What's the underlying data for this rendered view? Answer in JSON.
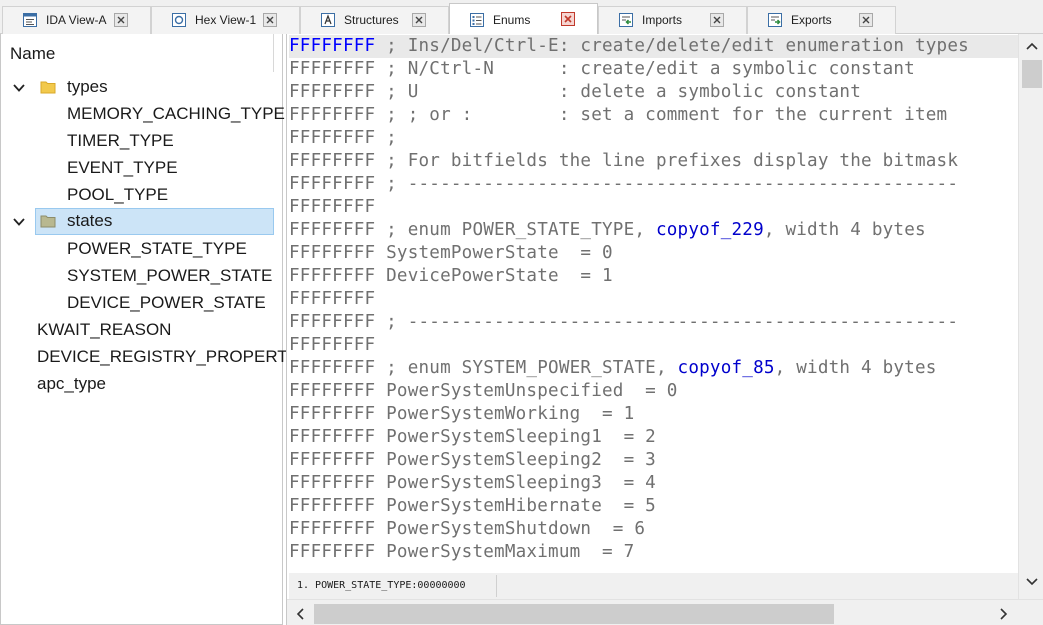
{
  "tabs": [
    {
      "label": "IDA View-A",
      "icon": "disassembly-view-icon",
      "active": false
    },
    {
      "label": "Hex View-1",
      "icon": "hex-view-icon",
      "active": false
    },
    {
      "label": "Structures",
      "icon": "structures-icon",
      "active": false
    },
    {
      "label": "Enums",
      "icon": "enums-icon",
      "active": true
    },
    {
      "label": "Imports",
      "icon": "imports-icon",
      "active": false
    },
    {
      "label": "Exports",
      "icon": "exports-icon",
      "active": false
    }
  ],
  "tree": {
    "header": "Name",
    "nodes": [
      {
        "label": "types",
        "kind": "folder",
        "expanded": true
      },
      {
        "label": "MEMORY_CACHING_TYPE"
      },
      {
        "label": "TIMER_TYPE"
      },
      {
        "label": "EVENT_TYPE"
      },
      {
        "label": "POOL_TYPE"
      },
      {
        "label": "states",
        "kind": "folder",
        "expanded": true,
        "selected": true
      },
      {
        "label": "POWER_STATE_TYPE"
      },
      {
        "label": "SYSTEM_POWER_STATE"
      },
      {
        "label": "DEVICE_POWER_STATE"
      },
      {
        "label": "KWAIT_REASON"
      },
      {
        "label": "DEVICE_REGISTRY_PROPERTY"
      },
      {
        "label": "apc_type"
      }
    ]
  },
  "listing": {
    "lines": [
      {
        "addr": "FFFFFFFF",
        "pre": " ; Ins/Del/Ctrl-E: create/delete/edit enumeration types",
        "ref": "",
        "post": ""
      },
      {
        "addr": "FFFFFFFF",
        "pre": " ; N/Ctrl-N      : create/edit a symbolic constant",
        "ref": "",
        "post": ""
      },
      {
        "addr": "FFFFFFFF",
        "pre": " ; U             : delete a symbolic constant",
        "ref": "",
        "post": ""
      },
      {
        "addr": "FFFFFFFF",
        "pre": " ; ; or :        : set a comment for the current item",
        "ref": "",
        "post": ""
      },
      {
        "addr": "FFFFFFFF",
        "pre": " ;",
        "ref": "",
        "post": ""
      },
      {
        "addr": "FFFFFFFF",
        "pre": " ; For bitfields the line prefixes display the bitmask",
        "ref": "",
        "post": ""
      },
      {
        "addr": "FFFFFFFF",
        "pre": " ; ---------------------------------------------------",
        "ref": "",
        "post": ""
      },
      {
        "addr": "FFFFFFFF",
        "pre": "",
        "ref": "",
        "post": ""
      },
      {
        "addr": "FFFFFFFF",
        "pre": " ; enum POWER_STATE_TYPE, ",
        "ref": "copyof_229",
        "post": ", width 4 bytes"
      },
      {
        "addr": "FFFFFFFF",
        "pre": " SystemPowerState  = 0",
        "ref": "",
        "post": ""
      },
      {
        "addr": "FFFFFFFF",
        "pre": " DevicePowerState  = 1",
        "ref": "",
        "post": ""
      },
      {
        "addr": "FFFFFFFF",
        "pre": "",
        "ref": "",
        "post": ""
      },
      {
        "addr": "FFFFFFFF",
        "pre": " ; ---------------------------------------------------",
        "ref": "",
        "post": ""
      },
      {
        "addr": "FFFFFFFF",
        "pre": "",
        "ref": "",
        "post": ""
      },
      {
        "addr": "FFFFFFFF",
        "pre": " ; enum SYSTEM_POWER_STATE, ",
        "ref": "copyof_85",
        "post": ", width 4 bytes"
      },
      {
        "addr": "FFFFFFFF",
        "pre": " PowerSystemUnspecified  = 0",
        "ref": "",
        "post": ""
      },
      {
        "addr": "FFFFFFFF",
        "pre": " PowerSystemWorking  = 1",
        "ref": "",
        "post": ""
      },
      {
        "addr": "FFFFFFFF",
        "pre": " PowerSystemSleeping1  = 2",
        "ref": "",
        "post": ""
      },
      {
        "addr": "FFFFFFFF",
        "pre": " PowerSystemSleeping2  = 3",
        "ref": "",
        "post": ""
      },
      {
        "addr": "FFFFFFFF",
        "pre": " PowerSystemSleeping3  = 4",
        "ref": "",
        "post": ""
      },
      {
        "addr": "FFFFFFFF",
        "pre": " PowerSystemHibernate  = 5",
        "ref": "",
        "post": ""
      },
      {
        "addr": "FFFFFFFF",
        "pre": " PowerSystemShutdown  = 6",
        "ref": "",
        "post": ""
      },
      {
        "addr": "FFFFFFFF",
        "pre": " PowerSystemMaximum  = 7",
        "ref": "",
        "post": ""
      }
    ],
    "status": "1. POWER_STATE_TYPE:00000000"
  },
  "colors": {
    "address": "#707070",
    "cursor_address": "#0000ff",
    "reference": "#0000cc",
    "selection": "#cce4f7",
    "highlight_line": "#e9e9e9",
    "folder": "#f2c94c"
  }
}
